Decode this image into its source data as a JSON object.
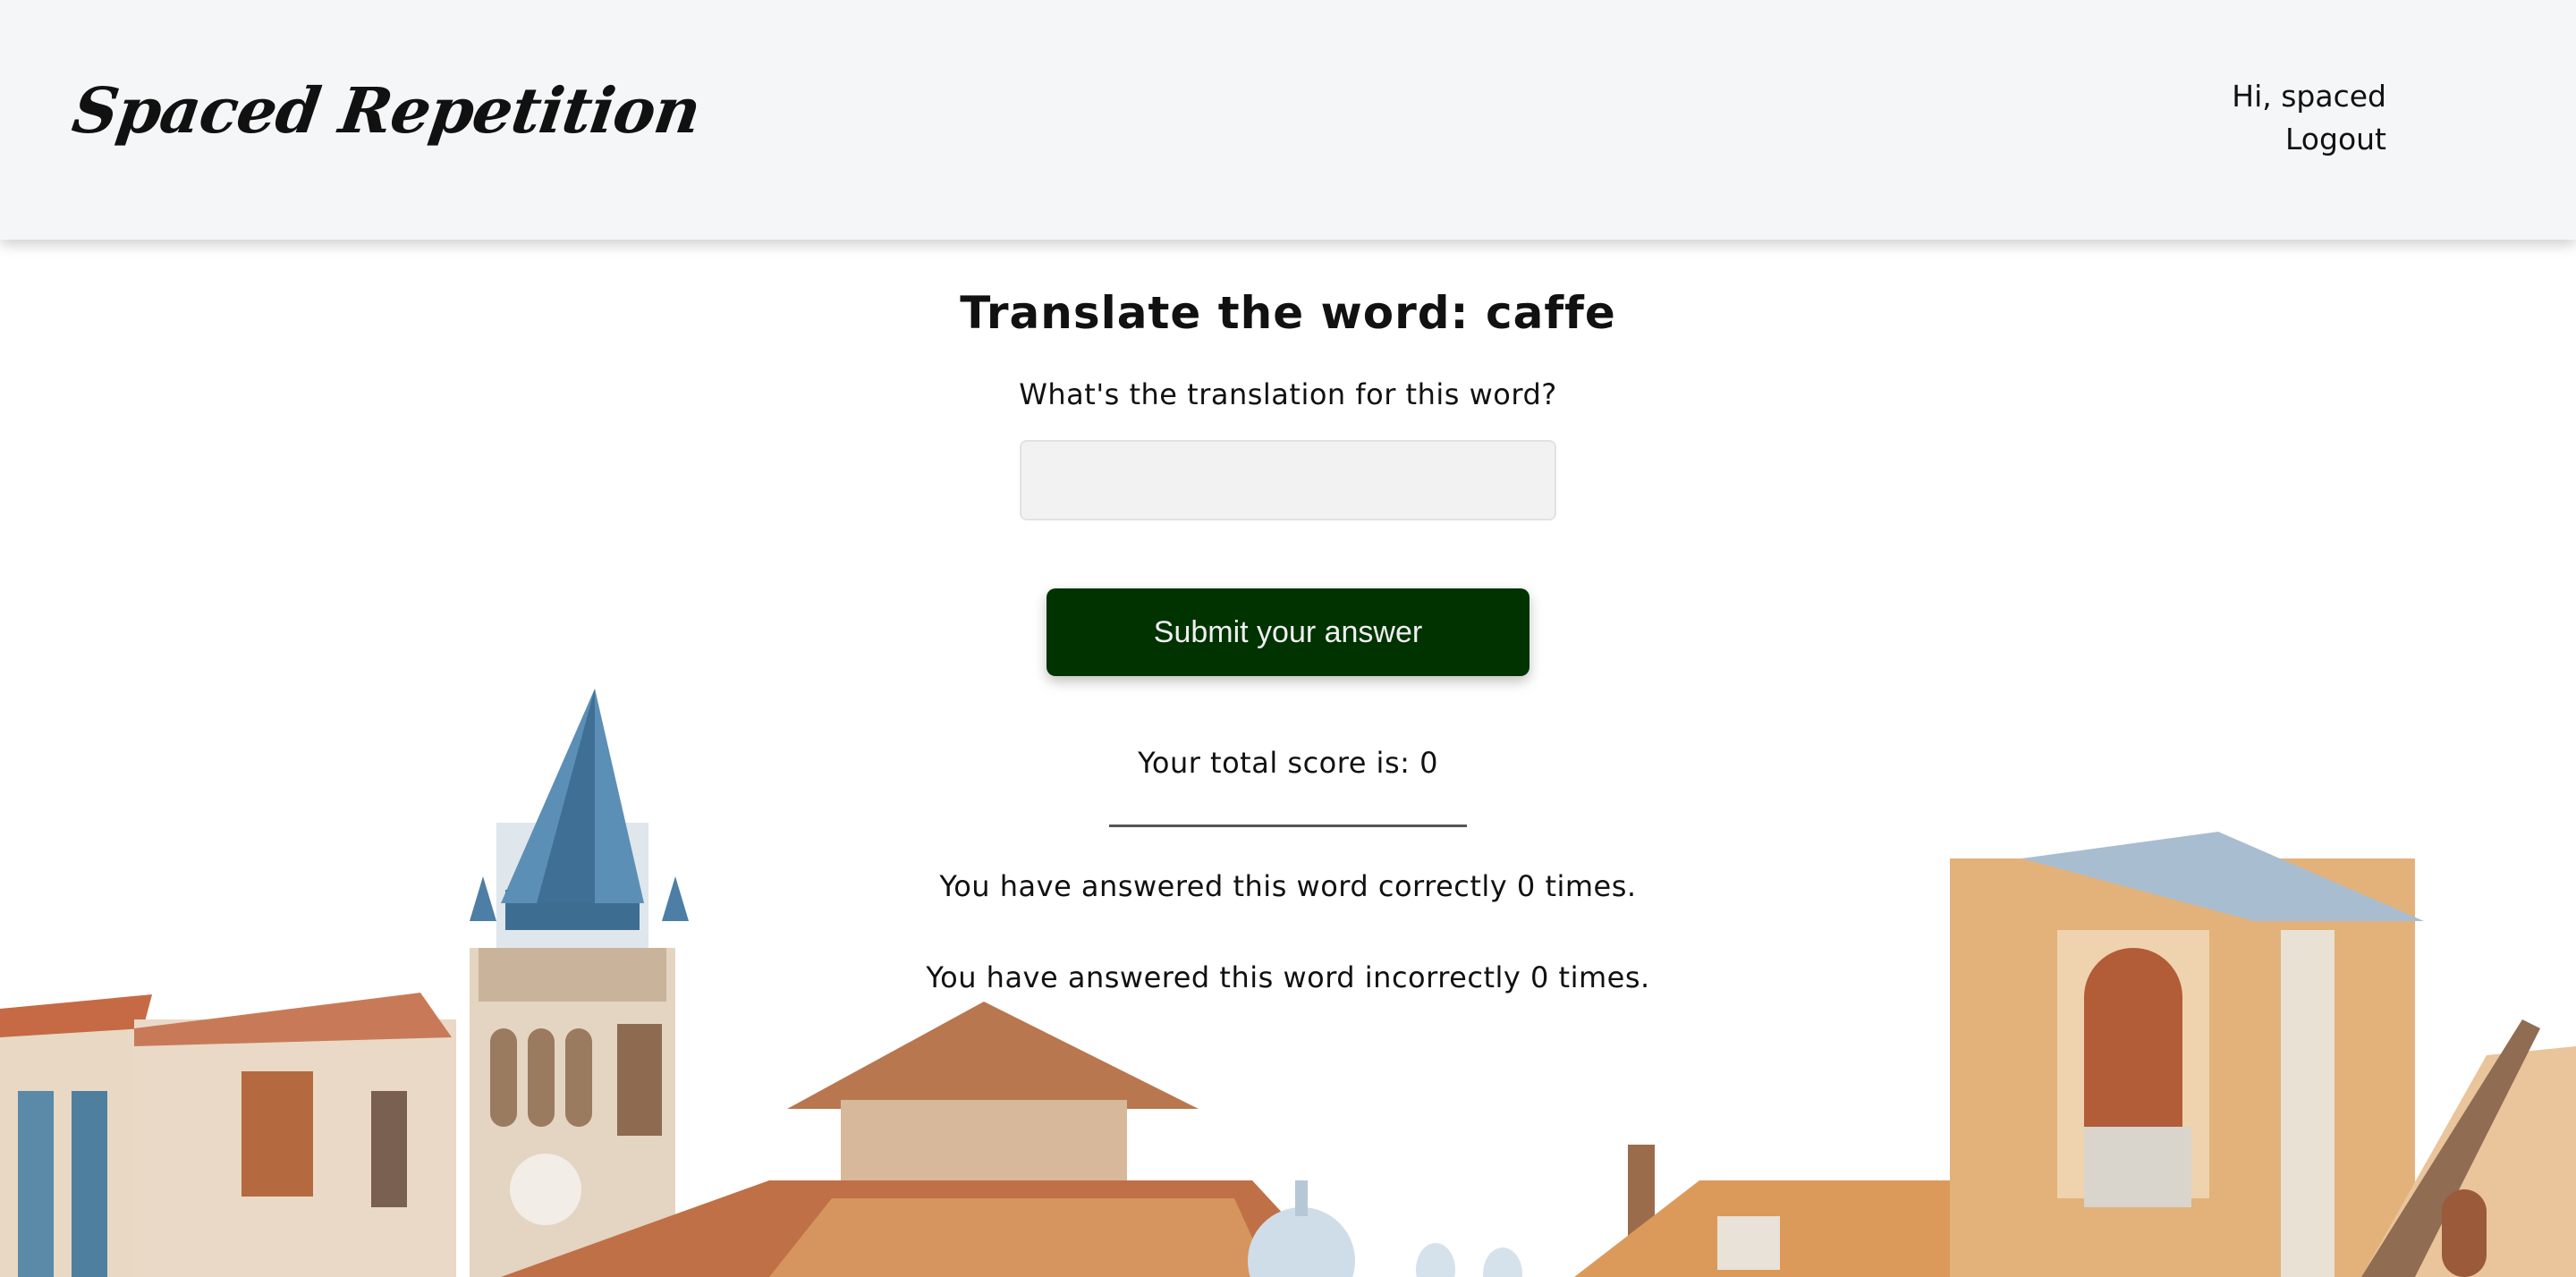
{
  "header": {
    "logo": "Spaced Repetition",
    "greeting": "Hi, spaced",
    "logout_label": "Logout"
  },
  "learn": {
    "title_prefix": "Translate the word:",
    "word": "caffe",
    "prompt": "What's the translation for this word?",
    "input_value": "",
    "input_placeholder": "",
    "submit_label": "Submit your answer",
    "score_text": "Your total score is: 0",
    "correct_text": "You have answered this word correctly 0 times.",
    "incorrect_text": "You have answered this word incorrectly 0 times."
  },
  "colors": {
    "header_bg": "#f4f6f7",
    "button_bg": "#003300",
    "input_bg": "#f2f2f2"
  }
}
